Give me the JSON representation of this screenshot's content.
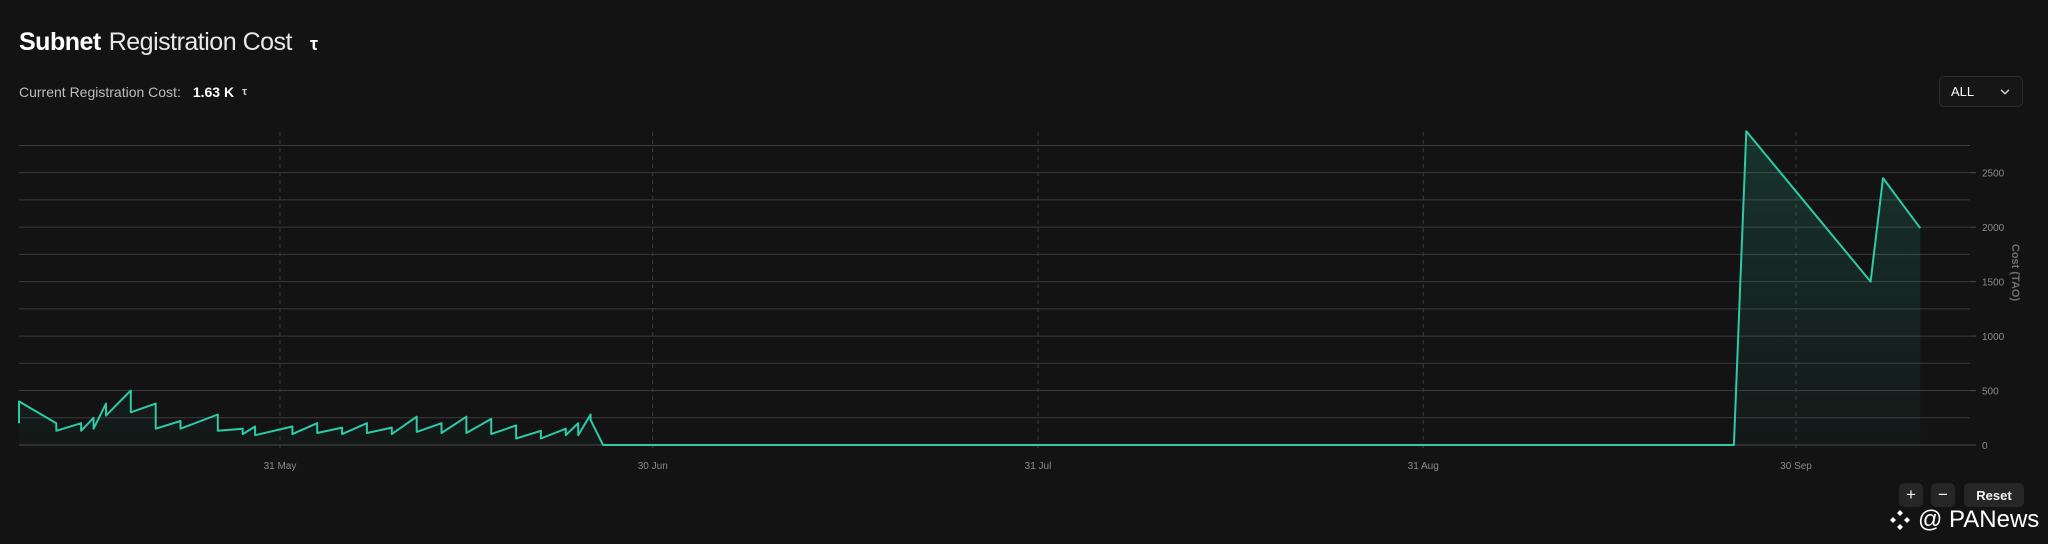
{
  "header": {
    "title_bold": "Subnet",
    "title_rest": "Registration Cost",
    "title_symbol": "τ"
  },
  "current": {
    "label": "Current Registration Cost:",
    "value": "1.63 K",
    "symbol": "τ"
  },
  "range_select": {
    "selected": "ALL"
  },
  "controls": {
    "zoom_in": "+",
    "zoom_out": "−",
    "reset": "Reset"
  },
  "watermark": {
    "text": "@ PANews"
  },
  "colors": {
    "line": "#2ec9a6",
    "grid": "#3a3a3a",
    "vgrid": "#3c3c3c",
    "tick": "#8a8a8a",
    "background": "#131313"
  },
  "chart_data": {
    "type": "area",
    "title": "",
    "xlabel": "",
    "ylabel": "Cost (TAO)",
    "x_type": "date",
    "xlim": [
      "2025-05-10",
      "2025-10-14"
    ],
    "ylim": [
      0,
      2800
    ],
    "y_ticks": [
      0,
      500,
      1000,
      1500,
      2000,
      2500
    ],
    "x_ticks": [
      {
        "label": "31 May",
        "date": "2025-05-31"
      },
      {
        "label": "30 Jun",
        "date": "2025-06-30"
      },
      {
        "label": "31 Jul",
        "date": "2025-07-31"
      },
      {
        "label": "31 Aug",
        "date": "2025-08-31"
      },
      {
        "label": "30 Sep",
        "date": "2025-09-30"
      }
    ],
    "grid": {
      "horizontal": true,
      "vertical": true
    },
    "series": [
      {
        "x": [
          "2025-05-10",
          "2025-05-10",
          "2025-05-13",
          "2025-05-13",
          "2025-05-15",
          "2025-05-15",
          "2025-05-16",
          "2025-05-16",
          "2025-05-17",
          "2025-05-17",
          "2025-05-19",
          "2025-05-19",
          "2025-05-21",
          "2025-05-21",
          "2025-05-23",
          "2025-05-23",
          "2025-05-26",
          "2025-05-26",
          "2025-05-28",
          "2025-05-28",
          "2025-05-29",
          "2025-05-29",
          "2025-06-01",
          "2025-06-01",
          "2025-06-03",
          "2025-06-03",
          "2025-06-05",
          "2025-06-05",
          "2025-06-07",
          "2025-06-07",
          "2025-06-09",
          "2025-06-09",
          "2025-06-11",
          "2025-06-11",
          "2025-06-13",
          "2025-06-13",
          "2025-06-15",
          "2025-06-15",
          "2025-06-17",
          "2025-06-17",
          "2025-06-19",
          "2025-06-19",
          "2025-06-21",
          "2025-06-21",
          "2025-06-23",
          "2025-06-23",
          "2025-06-24",
          "2025-06-24",
          "2025-06-25",
          "2025-06-25",
          "2025-06-26",
          "2025-06-26",
          "2025-06-30",
          "2025-07-01",
          "2025-09-25",
          "2025-09-26",
          "2025-10-06",
          "2025-10-07",
          "2025-10-10"
        ],
        "values": [
          200,
          400,
          200,
          130,
          200,
          130,
          250,
          150,
          380,
          270,
          500,
          300,
          380,
          150,
          220,
          150,
          280,
          130,
          150,
          100,
          170,
          90,
          170,
          100,
          200,
          110,
          160,
          100,
          200,
          110,
          160,
          100,
          260,
          120,
          200,
          110,
          260,
          110,
          240,
          100,
          180,
          60,
          130,
          60,
          150,
          90,
          200,
          90,
          280,
          230,
          0,
          0,
          0,
          0,
          0,
          2880,
          1500,
          2450,
          1990
        ]
      }
    ]
  }
}
